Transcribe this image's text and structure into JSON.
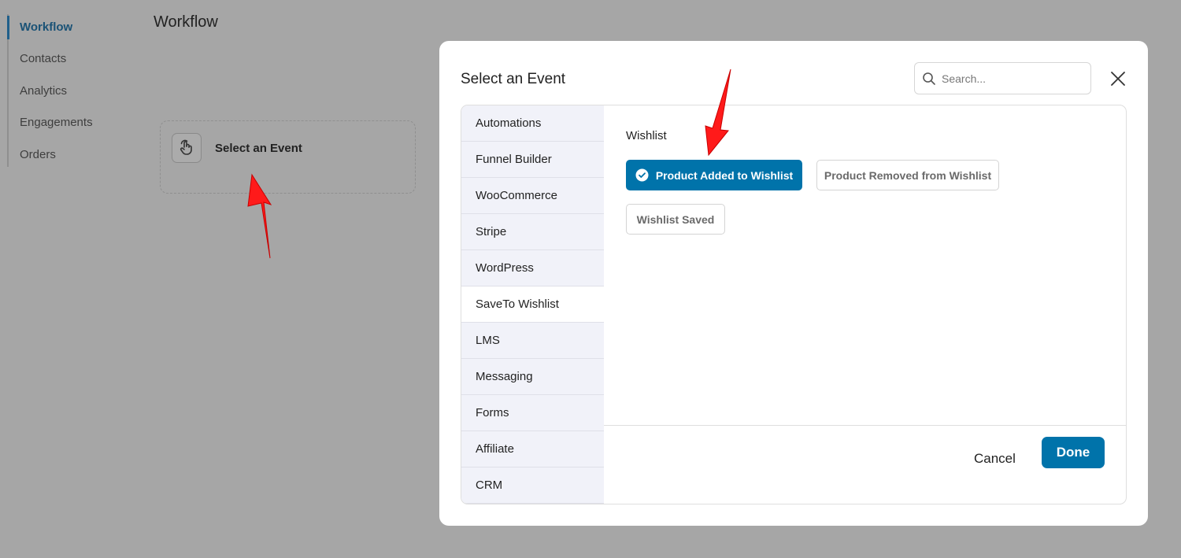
{
  "sidebar": {
    "items": [
      {
        "label": "Workflow",
        "active": true
      },
      {
        "label": "Contacts"
      },
      {
        "label": "Analytics"
      },
      {
        "label": "Engagements"
      },
      {
        "label": "Orders"
      }
    ]
  },
  "page": {
    "title": "Workflow",
    "trigger_card": {
      "label": "Select an Event",
      "icon": "hand-pointer-icon"
    }
  },
  "modal": {
    "title": "Select an Event",
    "search": {
      "placeholder": "Search..."
    },
    "categories": [
      {
        "label": "Automations"
      },
      {
        "label": "Funnel Builder"
      },
      {
        "label": "WooCommerce"
      },
      {
        "label": "Stripe"
      },
      {
        "label": "WordPress"
      },
      {
        "label": "SaveTo Wishlist",
        "selected": true
      },
      {
        "label": "LMS"
      },
      {
        "label": "Messaging"
      },
      {
        "label": "Forms"
      },
      {
        "label": "Affiliate"
      },
      {
        "label": "CRM"
      }
    ],
    "group_title": "Wishlist",
    "events": [
      {
        "label": "Product Added to Wishlist",
        "selected": true
      },
      {
        "label": "Product Removed from Wishlist"
      },
      {
        "label": "Wishlist Saved"
      }
    ],
    "cancel_label": "Cancel",
    "done_label": "Done"
  },
  "colors": {
    "accent": "#0073aa",
    "overlay": "#a6a6a6",
    "annotation_arrow": "#ff1a1a"
  }
}
